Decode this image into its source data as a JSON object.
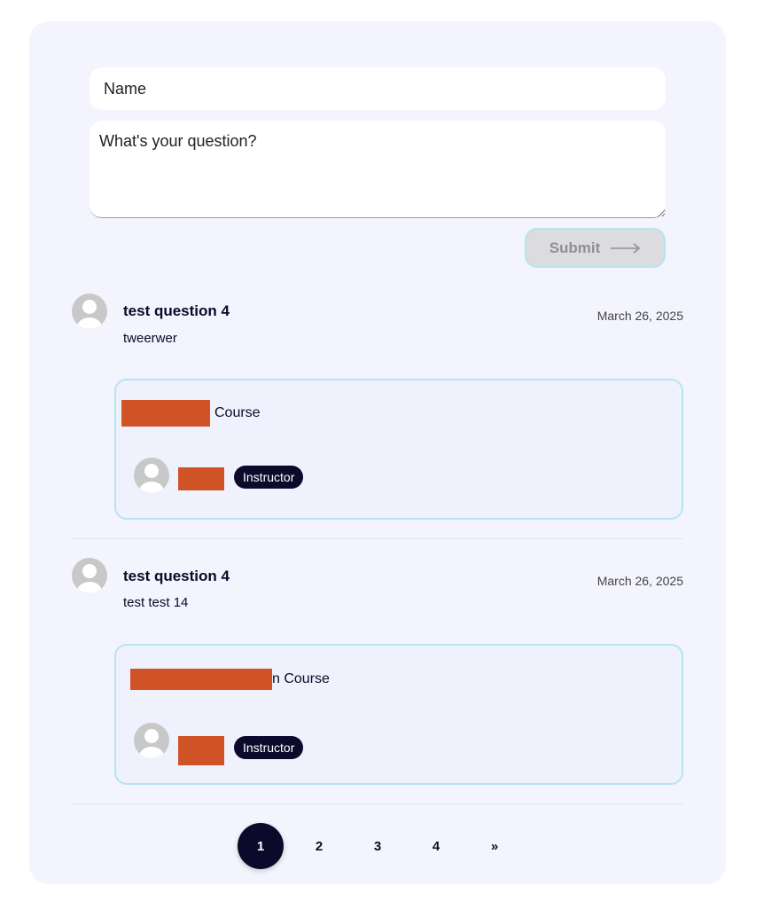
{
  "form": {
    "name_placeholder": "Name",
    "question_placeholder": "What's your question?",
    "submit_label": "Submit"
  },
  "questions": [
    {
      "title": "test question 4",
      "body": "tweerwer",
      "date": "March 26, 2025",
      "reply": {
        "course_suffix": "Course",
        "role": "Instructor"
      }
    },
    {
      "title": "test question 4",
      "body": "test test 14",
      "date": "March 26, 2025",
      "reply": {
        "course_suffix": "n Course",
        "role": "Instructor"
      }
    }
  ],
  "pagination": {
    "pages": [
      "1",
      "2",
      "3",
      "4"
    ],
    "next": "»",
    "current": "1"
  },
  "colors": {
    "panel_bg": "#f3f4fd",
    "dark": "#0b0a2a",
    "reply_border": "#b6e4f4",
    "redaction": "#d05327"
  }
}
